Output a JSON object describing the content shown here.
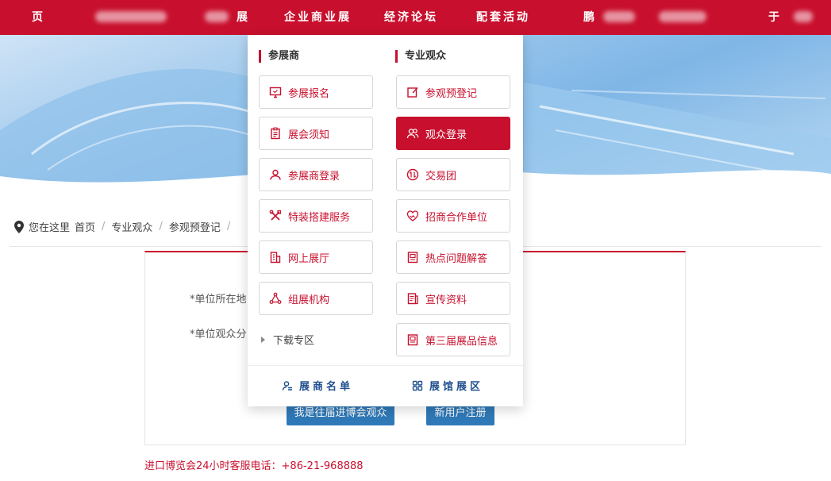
{
  "nav": {
    "items": [
      "页",
      "展",
      "企业商业展",
      "经济论坛",
      "配套活动",
      "鹏",
      "于"
    ]
  },
  "breadcrumb": {
    "prefix": "您在这里",
    "items": [
      "首页",
      "专业观众",
      "参观预登记"
    ],
    "sep": "/"
  },
  "form": {
    "label_region": "*单位所在地",
    "label_category": "*单位观众分",
    "btn_find": "我是往届进博会观众",
    "btn_new": "新用户注册"
  },
  "hotline": "进口博览会24小时客服电话：+86-21-968888",
  "menu": {
    "exhibitor_title": "参展商",
    "visitor_title": "专业观众",
    "exhibitor_items": [
      {
        "label": "参展报名",
        "icon": "monitor-icon"
      },
      {
        "label": "展会须知",
        "icon": "clipboard-icon"
      },
      {
        "label": "参展商登录",
        "icon": "user-icon"
      },
      {
        "label": "特装搭建服务",
        "icon": "tools-icon"
      },
      {
        "label": "网上展厅",
        "icon": "building-icon"
      },
      {
        "label": "组展机构",
        "icon": "network-icon"
      }
    ],
    "visitor_items": [
      {
        "label": "参观预登记",
        "icon": "edit-icon",
        "active": false
      },
      {
        "label": "观众登录",
        "icon": "users-icon",
        "active": true
      },
      {
        "label": "交易团",
        "icon": "exchange-icon",
        "active": false
      },
      {
        "label": "招商合作单位",
        "icon": "handshake-icon",
        "active": false
      },
      {
        "label": "热点问题解答",
        "icon": "document-icon",
        "active": false
      },
      {
        "label": "宣传资料",
        "icon": "brochure-icon",
        "active": false
      },
      {
        "label": "第三届展品信息",
        "icon": "document-icon",
        "active": false
      }
    ],
    "download": "下载专区",
    "footer_exhibitor_list": "展商名单",
    "footer_hall_area": "展馆展区"
  },
  "colors": {
    "brand_red": "#c8102e",
    "link_blue": "#1f4f8f",
    "button_blue": "#2f79b8"
  }
}
